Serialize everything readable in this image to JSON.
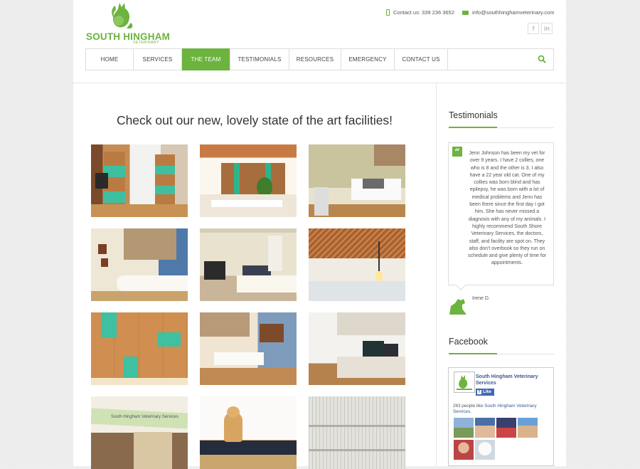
{
  "brand": {
    "name": "SOUTH HINGHAM",
    "sub": "VETERINARY"
  },
  "contact": {
    "phone": "Contact us: 339 236 3652",
    "email": "info@southhinghamveterinary.com"
  },
  "social": [
    {
      "icon": "facebook-icon",
      "label": "f"
    },
    {
      "icon": "linkedin-icon",
      "label": "in"
    }
  ],
  "nav": {
    "items": [
      "HOME",
      "SERVICES",
      "THE TEAM",
      "TESTIMONIALS",
      "RESOURCES",
      "EMERGENCY",
      "CONTACT US"
    ],
    "active": "THE TEAM"
  },
  "main": {
    "headline": "Check out our new, lovely state of the art facilities!"
  },
  "sidebar": {
    "testimonials": {
      "title": "Testimonials",
      "quote": "Jenn Johnson has been my vet for over 9 years. I have 2 collies, one who is 8 and the other is 3. I also have a 22 year old cat. One of my collies was born blind and has epilepsy, he was born with a lot of medical problems and Jenn has been there since the first day I got him. She has never missed a diagnosis with any of my animals. I highly recommend South Shore Veterinary Services, the doctors, staff, and facility are spot on. They also don't overbook so they run on schedule and give plenty of time for appointments.",
      "author": "Irene D."
    },
    "facebook": {
      "title": "Facebook",
      "page_name": "South Hingham Veterinary Services",
      "like_label": "Like",
      "count_text": "263 people like",
      "count_link": "South Hingham Veterinary Services."
    }
  },
  "colors": {
    "accent": "#6db33f",
    "facebook": "#3b5998"
  }
}
